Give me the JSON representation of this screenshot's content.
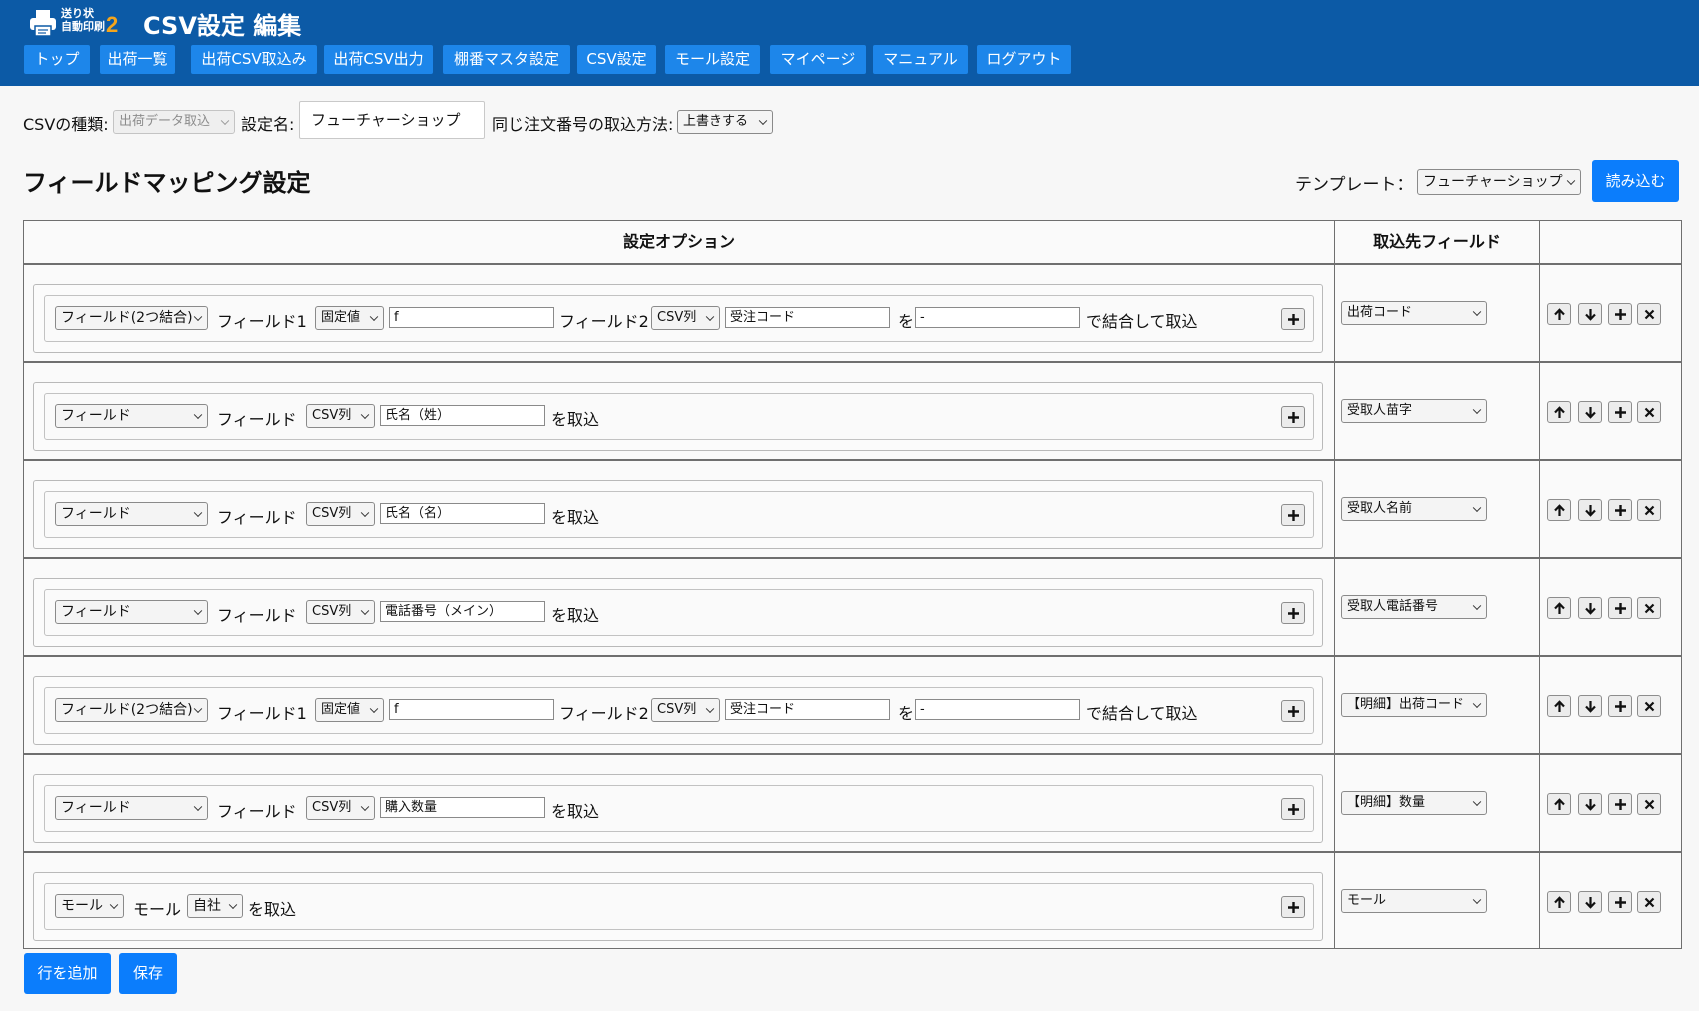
{
  "header": {
    "logo_line1": "送り状",
    "logo_line2": "自動印刷",
    "logo_num": "2",
    "title": "CSV設定 編集"
  },
  "nav": [
    "トップ",
    "出荷一覧",
    "出荷CSV取込み",
    "出荷CSV出力",
    "棚番マスタ設定",
    "CSV設定",
    "モール設定",
    "マイページ",
    "マニュアル",
    "ログアウト"
  ],
  "settings": {
    "csv_type_label": "CSVの種類:",
    "csv_type_value": "出荷データ取込",
    "name_label": "設定名:",
    "name_value": "フューチャーショップ",
    "dup_label": "同じ注文番号の取込方法:",
    "dup_value": "上書きする"
  },
  "section": {
    "title": "フィールドマッピング設定",
    "template_label": "テンプレート：",
    "template_value": "フューチャーショップ",
    "load_button": "読み込む"
  },
  "table": {
    "col_options": "設定オプション",
    "col_dest": "取込先フィールド",
    "rows": [
      {
        "type": "combine",
        "kind": "フィールド(2つ結合)",
        "field1_label": "フィールド1",
        "field1_src": "固定値",
        "field1_value": "f",
        "field2_label": "フィールド2",
        "field2_src": "CSV列",
        "field2_value": "受注コード",
        "wo_label": "を",
        "sep_value": "-",
        "suffix": "で結合して取込",
        "dest": "出荷コード"
      },
      {
        "type": "field",
        "kind": "フィールド",
        "field_label": "フィールド",
        "src": "CSV列",
        "value": "氏名（姓）",
        "suffix": "を取込",
        "dest": "受取人苗字"
      },
      {
        "type": "field",
        "kind": "フィールド",
        "field_label": "フィールド",
        "src": "CSV列",
        "value": "氏名（名）",
        "suffix": "を取込",
        "dest": "受取人名前"
      },
      {
        "type": "field",
        "kind": "フィールド",
        "field_label": "フィールド",
        "src": "CSV列",
        "value": "電話番号（メイン）",
        "suffix": "を取込",
        "dest": "受取人電話番号"
      },
      {
        "type": "combine",
        "kind": "フィールド(2つ結合)",
        "field1_label": "フィールド1",
        "field1_src": "固定値",
        "field1_value": "f",
        "field2_label": "フィールド2",
        "field2_src": "CSV列",
        "field2_value": "受注コード",
        "wo_label": "を",
        "sep_value": "-",
        "suffix": "で結合して取込",
        "dest": "【明細】出荷コード"
      },
      {
        "type": "field",
        "kind": "フィールド",
        "field_label": "フィールド",
        "src": "CSV列",
        "value": "購入数量",
        "suffix": "を取込",
        "dest": "【明細】数量"
      },
      {
        "type": "mall",
        "kind": "モール",
        "mall_label": "モール",
        "mall_value": "自社",
        "suffix": "を取込",
        "dest": "モール"
      }
    ]
  },
  "footer": {
    "add_row": "行を追加",
    "save": "保存"
  },
  "icons": {
    "printer": "printer-icon",
    "plus": "plus-icon",
    "up": "arrow-up-icon",
    "down": "arrow-down-icon",
    "delete": "close-icon",
    "chevron": "chevron-down-icon"
  },
  "colors": {
    "header_bg": "#0c5aa6",
    "nav_bg": "#1d86ea",
    "button_blue": "#0b7dfc",
    "logo_accent": "#f4a51c"
  }
}
